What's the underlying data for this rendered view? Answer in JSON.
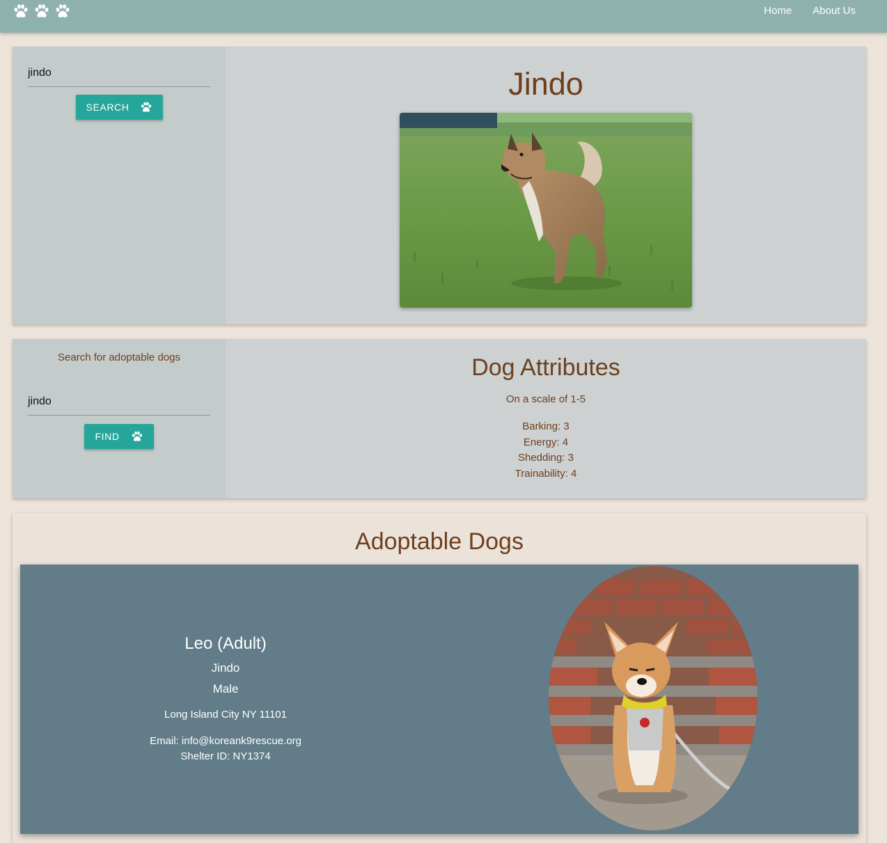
{
  "nav": {
    "brand_icons": [
      "paw-icon",
      "paw-icon",
      "paw-icon"
    ],
    "links": [
      "Home",
      "About Us"
    ]
  },
  "breed_search": {
    "input_value": "jindo",
    "button_label": "SEARCH",
    "button_icon": "paw-icon"
  },
  "breed_profile": {
    "title": "Jindo",
    "photo": "jindo-dog-on-grass"
  },
  "adoptable_search": {
    "caption": "Search for adoptable dogs",
    "input_value": "jindo",
    "button_label": "FIND",
    "button_icon": "paw-icon"
  },
  "attributes": {
    "title": "Dog Attributes",
    "subtitle": "On a scale of 1-5",
    "items": [
      "Barking: 3",
      "Energy: 4",
      "Shedding: 3",
      "Trainability: 4"
    ]
  },
  "adoptable": {
    "title": "Adoptable Dogs",
    "dogs": [
      {
        "name": "Leo (Adult)",
        "breed": "Jindo",
        "sex": "Male",
        "location": "Long Island City NY 11101",
        "email": "Email: info@koreank9rescue.org",
        "shelter": "Shelter ID: NY1374",
        "photo": "dog-sitting-on-brick-steps"
      }
    ]
  },
  "colors": {
    "navbar": "#8fb1ae",
    "page_background": "#ece3da",
    "panel": "#cdd1d2",
    "button": "#26a69a",
    "heading_text": "#6d3f1d",
    "card": "#627c89"
  }
}
